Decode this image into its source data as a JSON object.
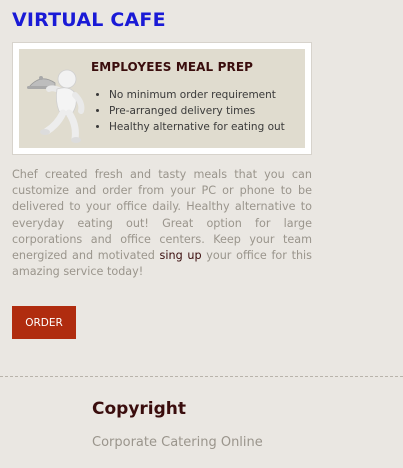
{
  "section": {
    "title": "VIRTUAL CAFE"
  },
  "promo": {
    "title": "EMPLOYEES MEAL PREP",
    "mascot_icon": "waiter-cloche-icon",
    "bullets": [
      "No minimum order requirement",
      "Pre-arranged delivery times",
      "Healthy alternative for eating out"
    ]
  },
  "description": {
    "text_before": "Chef created fresh and tasty meals that you can customize and order from your PC or phone to be delivered to your office daily. Healthy alternative to everyday eating out! Great option for large corporations and office centers. Keep your team energized and motivated ",
    "link_text": "sing up",
    "text_after": " your office for this amazing service today!"
  },
  "order_button": {
    "label": "ORDER"
  },
  "footer": {
    "title": "Copyright",
    "subtitle": "Corporate Catering Online"
  },
  "colors": {
    "background": "#eae7e2",
    "heading_blue": "#1a1ad6",
    "dark_maroon": "#3a0d0d",
    "button_red": "#b02c0f",
    "muted_text": "#9a958c"
  }
}
